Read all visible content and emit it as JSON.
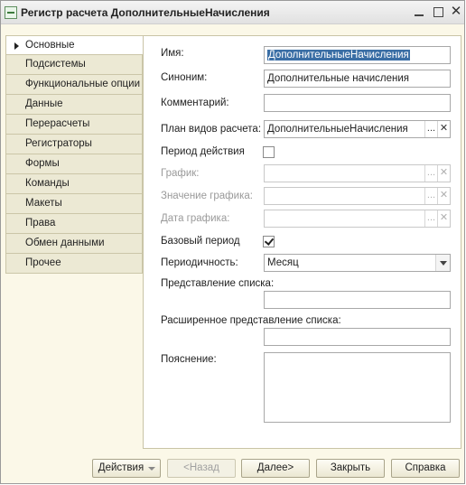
{
  "window": {
    "title": "Регистр расчета ДополнительныеНачисления"
  },
  "tabs": [
    {
      "label": "Основные",
      "active": true
    },
    {
      "label": "Подсистемы"
    },
    {
      "label": "Функциональные опции"
    },
    {
      "label": "Данные"
    },
    {
      "label": "Перерасчеты"
    },
    {
      "label": "Регистраторы"
    },
    {
      "label": "Формы"
    },
    {
      "label": "Команды"
    },
    {
      "label": "Макеты"
    },
    {
      "label": "Права"
    },
    {
      "label": "Обмен данными"
    },
    {
      "label": "Прочее"
    }
  ],
  "form": {
    "name_label": "Имя:",
    "name_value": "ДополнительныеНачисления",
    "synonym_label": "Синоним:",
    "synonym_value": "Дополнительные начисления",
    "comment_label": "Комментарий:",
    "comment_value": "",
    "chart_label": "План видов расчета:",
    "chart_value": "ДополнительныеНачисления",
    "action_period_label": "Период действия",
    "action_period_checked": false,
    "schedule_label": "График:",
    "schedule_value_label": "Значение графика:",
    "schedule_date_label": "Дата графика:",
    "base_period_label": "Базовый период",
    "base_period_checked": true,
    "periodicity_label": "Периодичность:",
    "periodicity_value": "Месяц",
    "list_presentation_label": "Представление списка:",
    "list_presentation_value": "",
    "ext_list_presentation_label": "Расширенное представление списка:",
    "ext_list_presentation_value": "",
    "explanation_label": "Пояснение:",
    "explanation_value": ""
  },
  "buttons": {
    "actions": "Действия",
    "back": "<Назад",
    "next": "Далее>",
    "close": "Закрыть",
    "help": "Справка"
  },
  "icons": {
    "ellipsis": "...",
    "clear": "✕"
  }
}
